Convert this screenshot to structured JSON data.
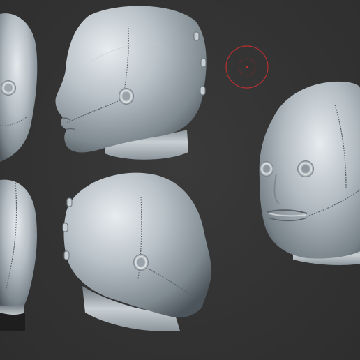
{
  "canvas": {
    "background_color": "#333333",
    "model_color": "#a5aeb4",
    "highlight_color": "#e3e8eb",
    "shadow_color": "#566067",
    "cursor_color": "#c23232"
  },
  "scene": {
    "views": [
      {
        "name": "head-front-left-partial",
        "description_icon": "sculpt-head"
      },
      {
        "name": "head-side-left",
        "description_icon": "sculpt-head"
      },
      {
        "name": "head-three-quarter-right",
        "description_icon": "sculpt-head"
      },
      {
        "name": "head-back-left-partial",
        "description_icon": "sculpt-head"
      },
      {
        "name": "head-back-three-quarter",
        "description_icon": "sculpt-head"
      }
    ],
    "brush_cursor_icon": "brush-circle-cursor"
  }
}
